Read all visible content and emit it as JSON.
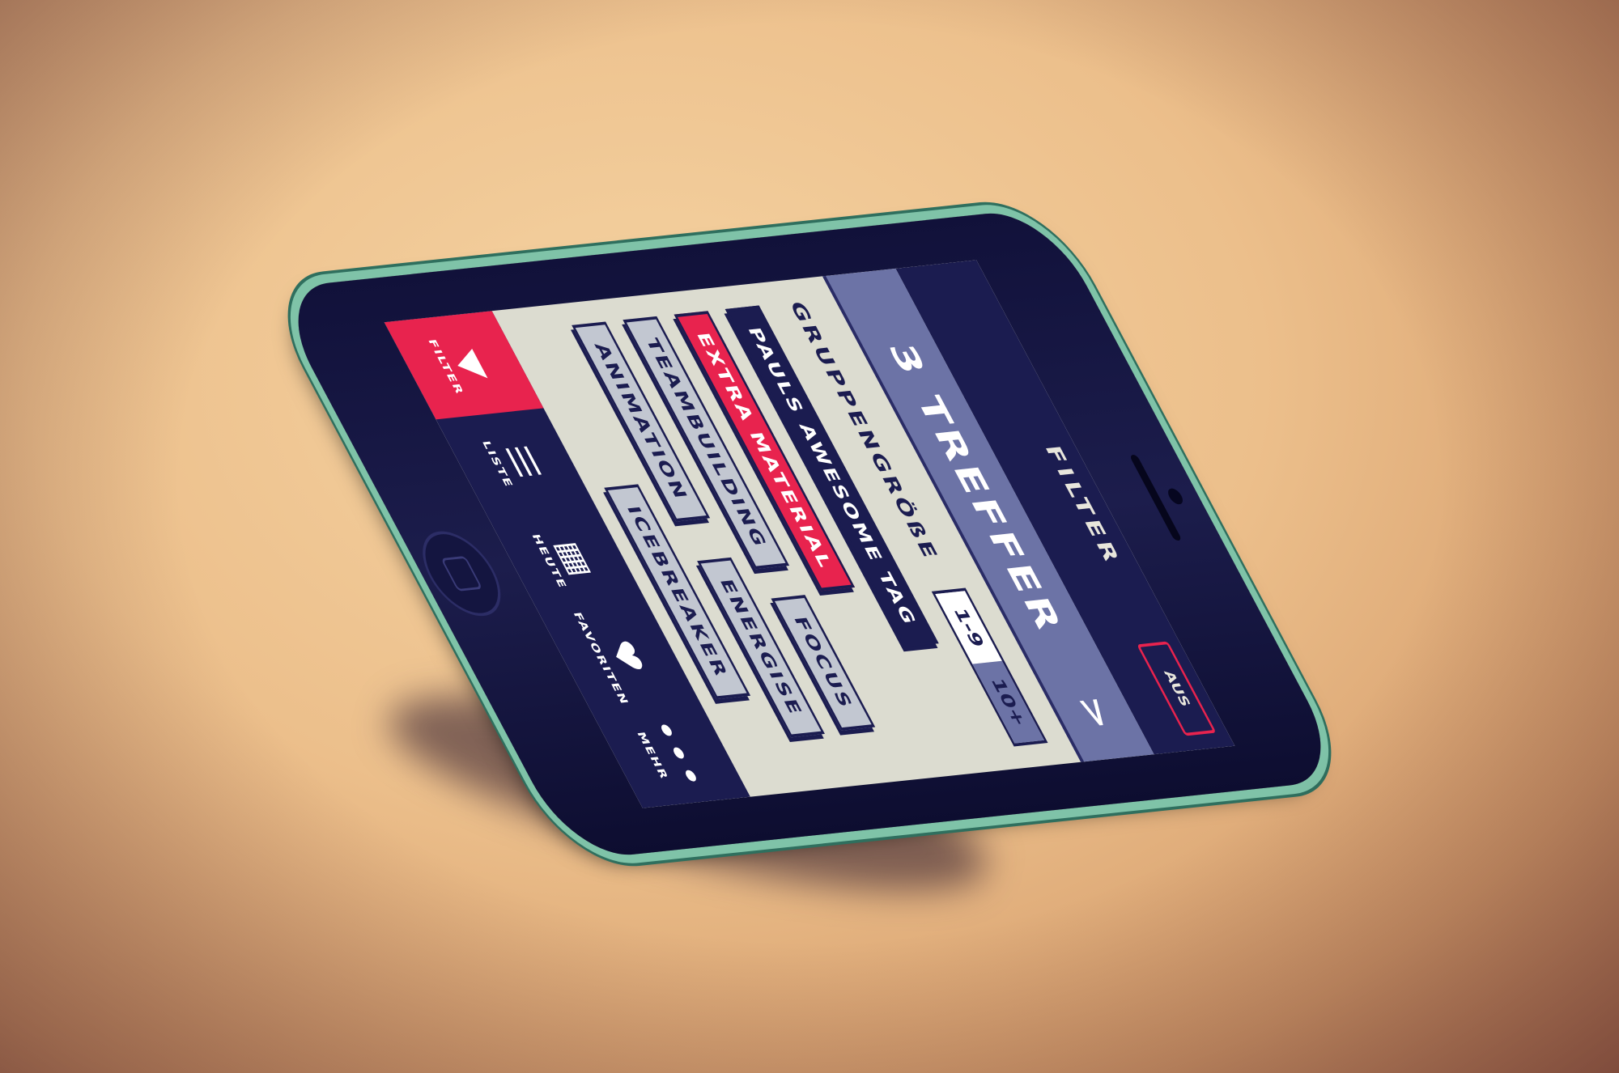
{
  "nav": {
    "title": "FILTER",
    "reset_label": "AUS"
  },
  "results": {
    "count_label": "3 TREFFER",
    "chevron": ">"
  },
  "group_size": {
    "label": "GRUPPENGRÖßE",
    "options": [
      "1-9",
      "10+"
    ],
    "selected": "1-9"
  },
  "tags": [
    {
      "label": "PAULS AWESOME TAG",
      "style": "dark"
    },
    {
      "label": "EXTRA MATERIAL",
      "style": "red"
    },
    {
      "label": "TEAMBUILDING",
      "style": "grey"
    },
    {
      "label": "FOCUS",
      "style": "grey"
    },
    {
      "label": "ANIMATION",
      "style": "grey"
    },
    {
      "label": "ENERGISE",
      "style": "grey"
    },
    {
      "label": "ICEBREAKER",
      "style": "grey"
    }
  ],
  "tabbar": {
    "items": [
      {
        "label": "FILTER",
        "icon": "filter-icon",
        "glyph": "▼",
        "active": true
      },
      {
        "label": "LISTE",
        "icon": "list-icon",
        "glyph": "☰",
        "active": false
      },
      {
        "label": "HEUTE",
        "icon": "calendar-icon",
        "glyph": "▦",
        "active": false
      },
      {
        "label": "FAVORITEN",
        "icon": "heart-icon",
        "glyph": "♥",
        "active": false
      },
      {
        "label": "MEHR",
        "icon": "more-icon",
        "glyph": "•••",
        "active": false
      }
    ]
  },
  "colors": {
    "accent": "#e8234e",
    "navy": "#1b1c50",
    "bar": "#6c73a6",
    "screen_bg": "#dcdcd0",
    "phone_rim": "#7fc3a8"
  }
}
